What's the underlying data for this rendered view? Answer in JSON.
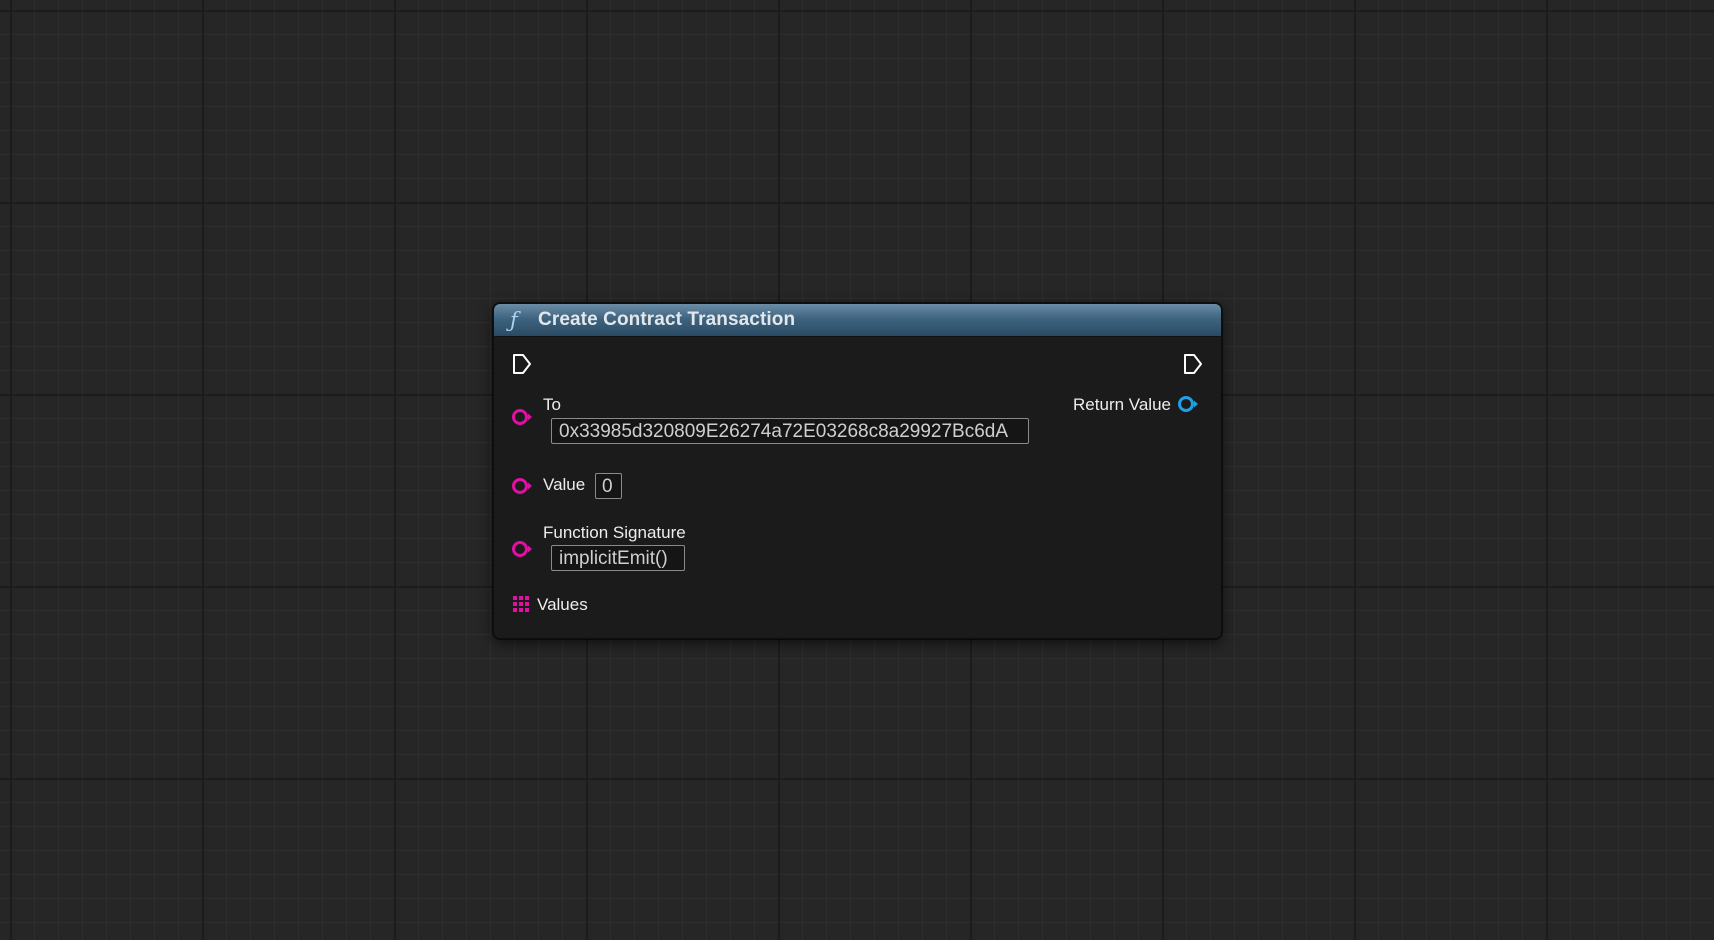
{
  "node": {
    "title": "Create Contract Transaction",
    "header_icon": "function-icon",
    "inputs": {
      "to": {
        "label": "To",
        "value": "0x33985d320809E26274a72E03268c8a29927Bc6dA"
      },
      "value": {
        "label": "Value",
        "value": "0"
      },
      "function_signature": {
        "label": "Function Signature",
        "value": "implicitEmit()"
      },
      "values": {
        "label": "Values"
      }
    },
    "outputs": {
      "return_value": {
        "label": "Return Value"
      }
    }
  },
  "colors": {
    "header_top": "#6a8ca7",
    "header_bottom": "#2a4a63",
    "string_pin": "#e10fa3",
    "struct_pin": "#1ea0e6",
    "exec_pin": "#ffffff",
    "canvas_bg": "#262626"
  }
}
